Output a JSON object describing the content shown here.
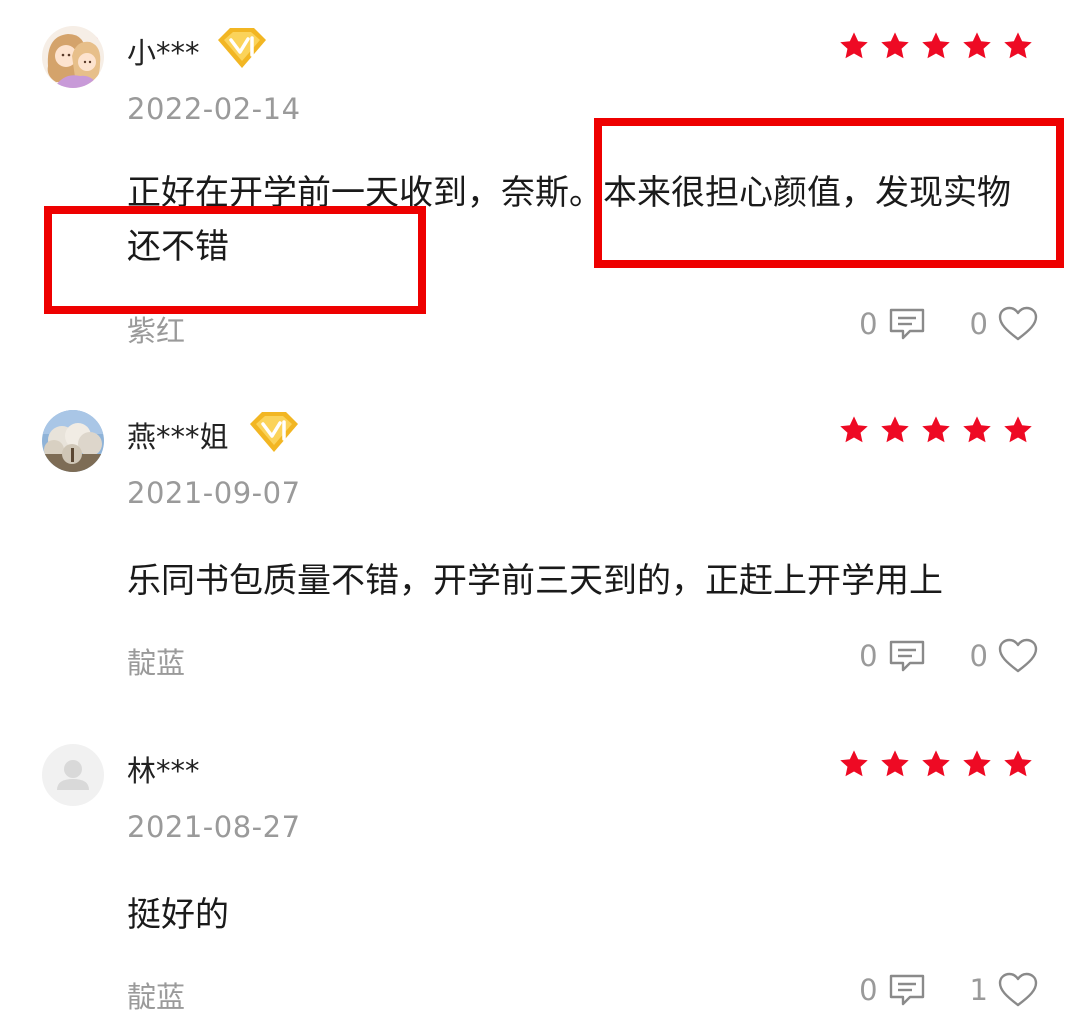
{
  "colors": {
    "star": "#ee0a24",
    "highlight": "#ee0000",
    "badge": "#f2b623",
    "muted": "#9a9a9a"
  },
  "reviews": [
    {
      "username": "小***",
      "vip": true,
      "rating": 5,
      "date": "2022-02-14",
      "content": "正好在开学前一天收到，奈斯。本来很担心颜值，发现实物还不错",
      "variant": "紫红",
      "comment_count": "0",
      "like_count": "0",
      "avatar_icon": "girls-cartoon-avatar"
    },
    {
      "username": "燕***姐",
      "vip": true,
      "rating": 5,
      "date": "2021-09-07",
      "content": "乐同书包质量不错，开学前三天到的，正赶上开学用上",
      "variant": "靛蓝",
      "comment_count": "0",
      "like_count": "0",
      "avatar_icon": "blossom-tree-avatar"
    },
    {
      "username": "林***",
      "vip": false,
      "rating": 5,
      "date": "2021-08-27",
      "content": "挺好的",
      "variant": "靛蓝",
      "comment_count": "0",
      "like_count": "1",
      "avatar_icon": "default-user-avatar"
    }
  ]
}
